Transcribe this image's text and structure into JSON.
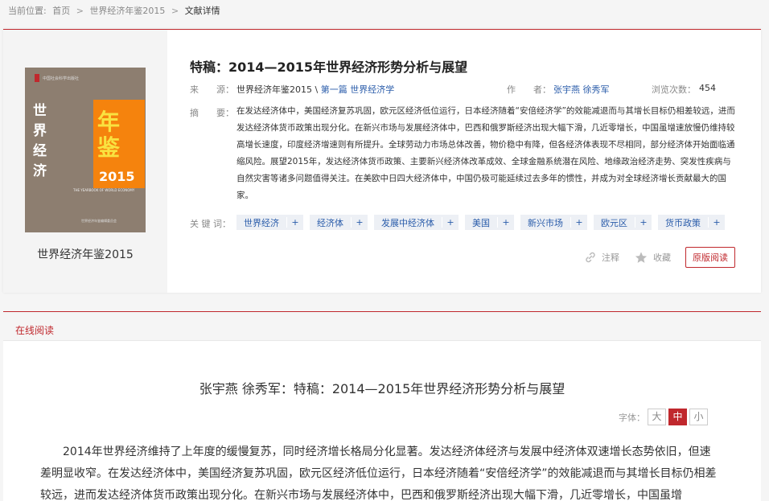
{
  "breadcrumb": {
    "label": "当前位置:",
    "items": [
      "首页",
      "世界经济年鉴2015",
      "文献详情"
    ],
    "separator": ">"
  },
  "cover": {
    "publisher_top": "中国社会科学出版社",
    "vertical_title": "世界经济",
    "nianjian": "年鉴",
    "year": "2015",
    "english": "THE YEARBOOK OF WORLD ECONOMY",
    "bottom_pub": "世界经济年鉴编辑委员会",
    "caption": "世界经济年鉴2015"
  },
  "article": {
    "title": "特稿：2014—2015年世界经济形势分析与展望",
    "source_label": "来　　源：",
    "source_book": "世界经济年鉴2015",
    "source_sep": "\\",
    "source_section": "第一篇 世界经济学",
    "author_label": "作　　者：",
    "authors": "张宇燕 徐秀军",
    "views_label": "浏览次数：",
    "views": "454",
    "abstract_label": "摘　　要：",
    "abstract": "在发达经济体中，美国经济复苏巩固，欧元区经济低位运行，日本经济随着“安倍经济学”的效能减退而与其增长目标仍相差较远，进而发达经济体货币政策出现分化。在新兴市场与发展经济体中，巴西和俄罗斯经济出现大幅下滑，几近零增长，中国虽增速放慢仍维持较高增长速度，印度经济增速则有所提升。全球劳动力市场总体改善，物价稳中有降，但各经济体表现不尽相同，部分经济体开始面临通缩风险。展望2015年，发达经济体货币政策、主要新兴经济体改革成效、全球金融系统潜在风险、地缘政治经济走势、突发性疾病与自然灾害等诸多问题值得关注。在美欧中日四大经济体中，中国仍极可能延续过去多年的惯性，并成为对全球经济增长贡献最大的国家。",
    "keywords_label": "关 键 词：",
    "keywords": [
      "世界经济",
      "经济体",
      "发展中经济体",
      "美国",
      "新兴市场",
      "欧元区",
      "货币政策"
    ],
    "keyword_plus": "+",
    "note_label": "注释",
    "fav_label": "收藏",
    "read_label": "原版阅读"
  },
  "reading": {
    "section_label": "在线阅读",
    "title": "张宇燕 徐秀军：特稿：2014—2015年世界经济形势分析与展望",
    "font_label": "字体：",
    "font_sizes": [
      "大",
      "中",
      "小"
    ],
    "active_font": "中",
    "body": "2014年世界经济维持了上年度的缓慢复苏，同时经济增长格局分化显著。发达经济体经济与发展中经济体双速增长态势依旧，但速差明显收窄。在发达经济体中，美国经济复苏巩固，欧元区经济低位运行，日本经济随着“安倍经济学”的效能减退而与其增长目标仍相差较远，进而发达经济体货币政策出现分化。在新兴市场与发展经济体中，巴西和俄罗斯经济出现大幅下滑，几近零增长，中国虽增"
  },
  "colors": {
    "accent": "#c0282d",
    "link": "#2a5caa",
    "keyword_bg": "#edf0f5"
  }
}
